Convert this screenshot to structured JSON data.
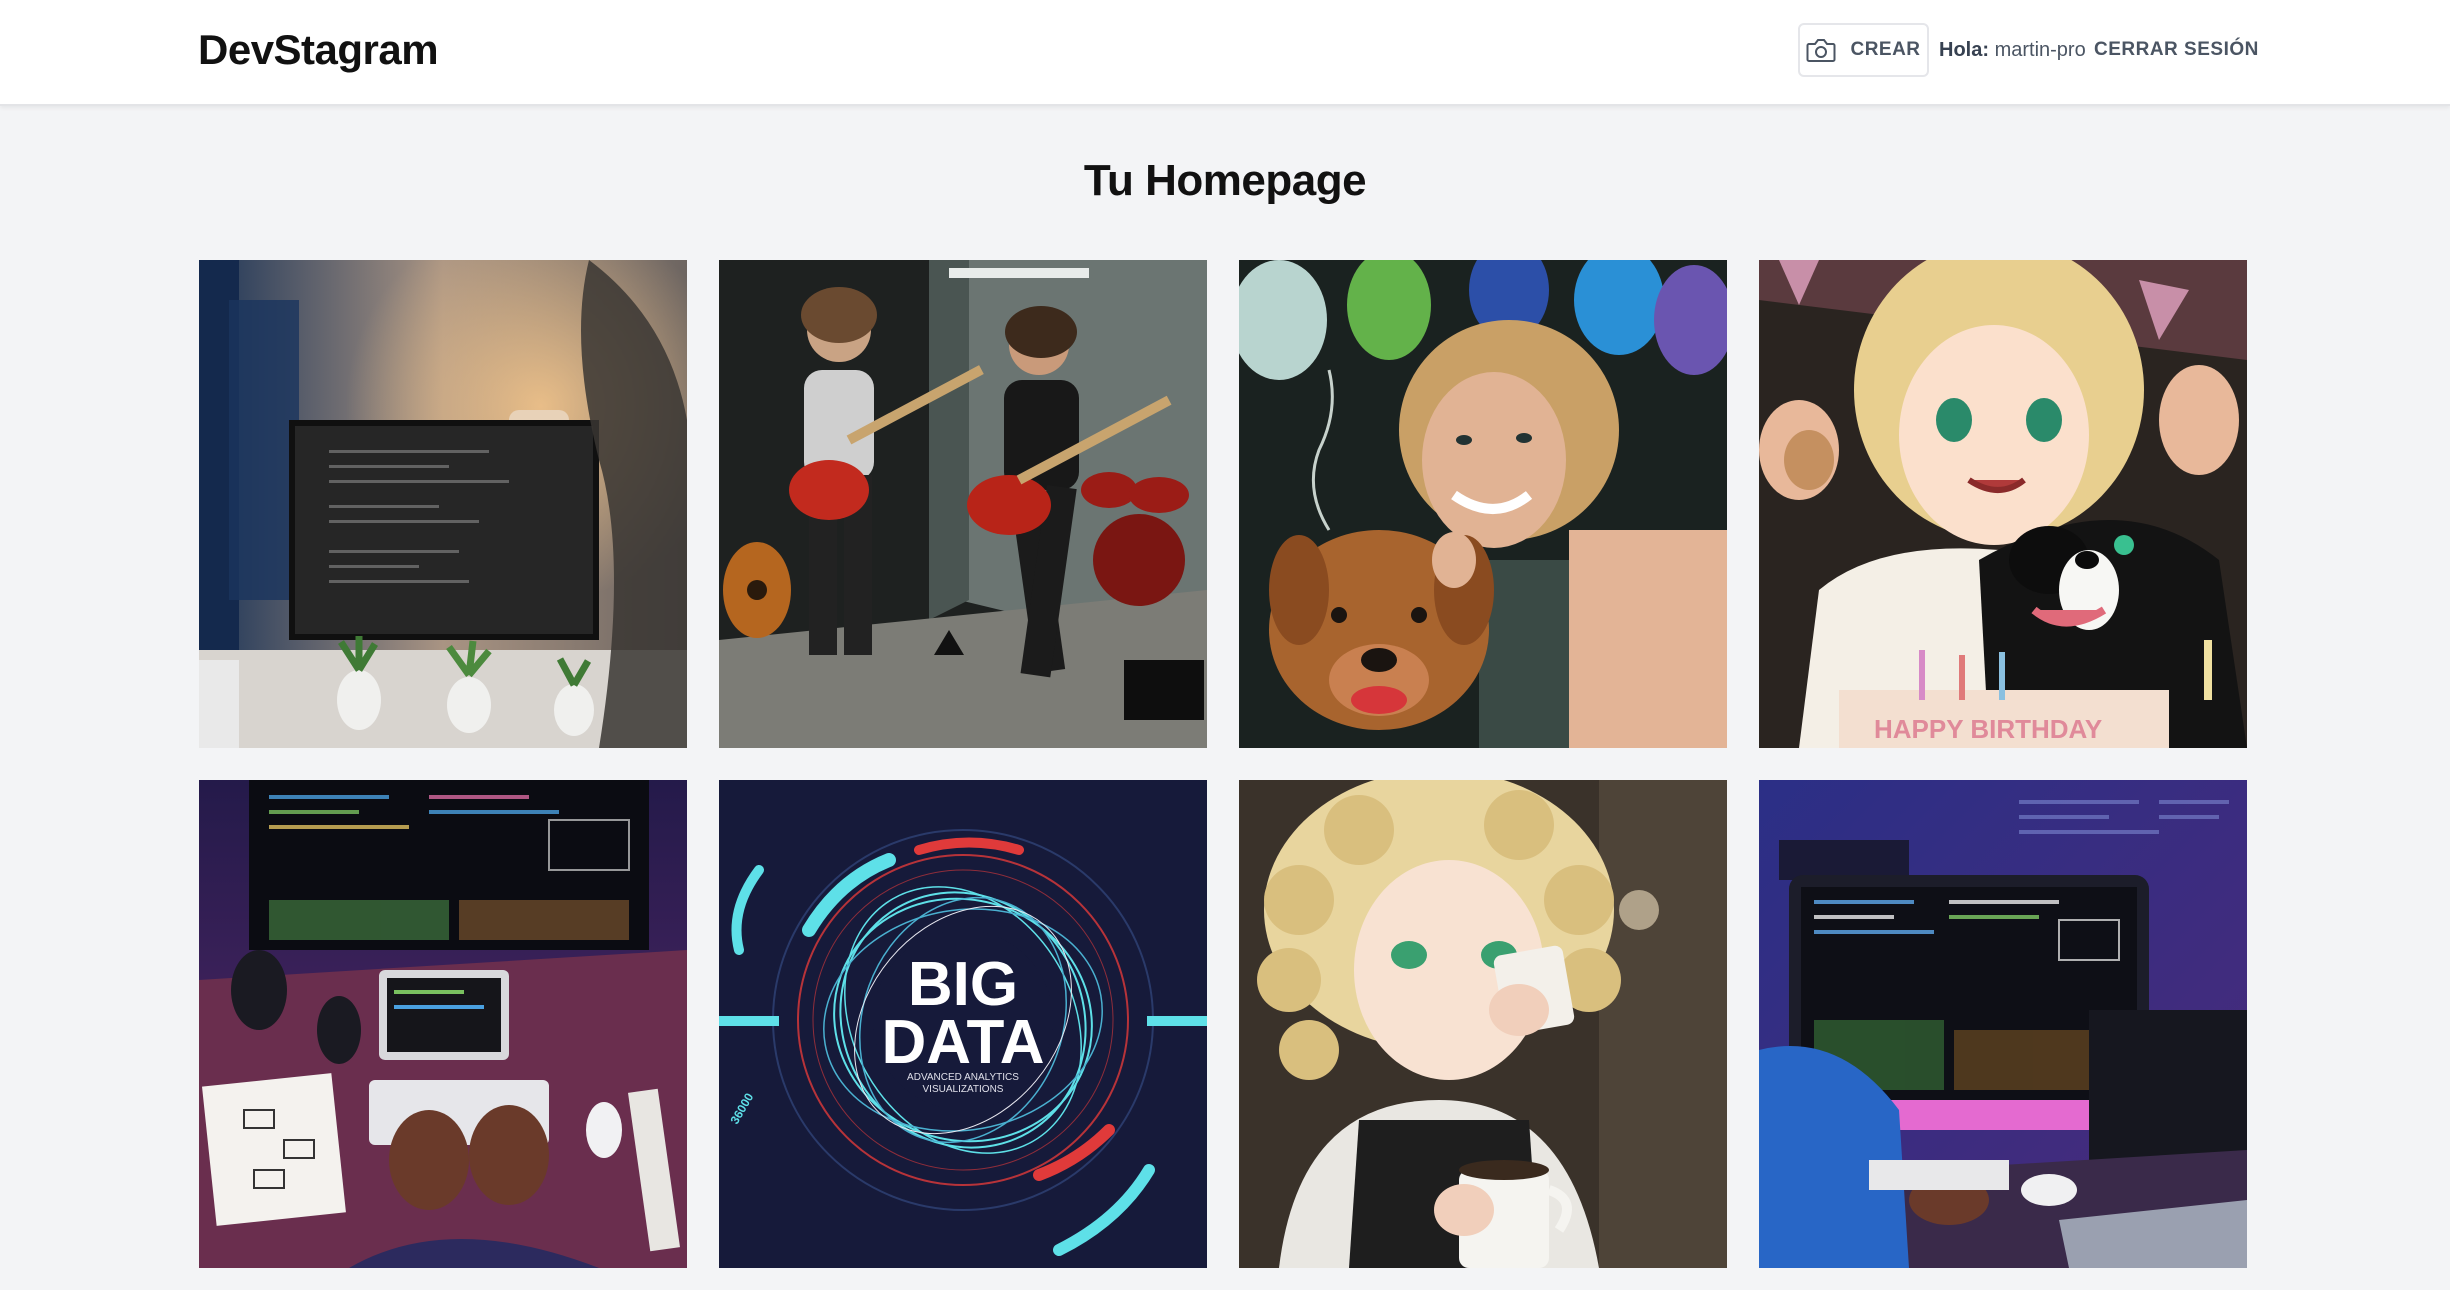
{
  "app": {
    "brand": "DevStagram"
  },
  "nav": {
    "create_label": "CREAR",
    "greeting_prefix": "Hola:",
    "username": "martin-pro",
    "logout_label": "CERRAR SESIÓN",
    "camera_icon": "camera-icon"
  },
  "page": {
    "title": "Tu Homepage"
  },
  "posts": [
    {
      "subject": "desk-monitor-code"
    },
    {
      "subject": "two-guitarists-rehearsal"
    },
    {
      "subject": "woman-with-dog-balloons"
    },
    {
      "subject": "anime-girl-dog-birthday",
      "caption": "HAPPY BIRTHDAY"
    },
    {
      "subject": "developer-desk-keyboard"
    },
    {
      "subject": "big-data-poster",
      "title_line1": "BIG",
      "title_line2": "DATA",
      "subtitle_line1": "ADVANCED ANALYTICS",
      "subtitle_line2": "VISUALIZATIONS",
      "side_number": "36000"
    },
    {
      "subject": "anime-girl-coffee"
    },
    {
      "subject": "developer-monitor-blue"
    }
  ]
}
